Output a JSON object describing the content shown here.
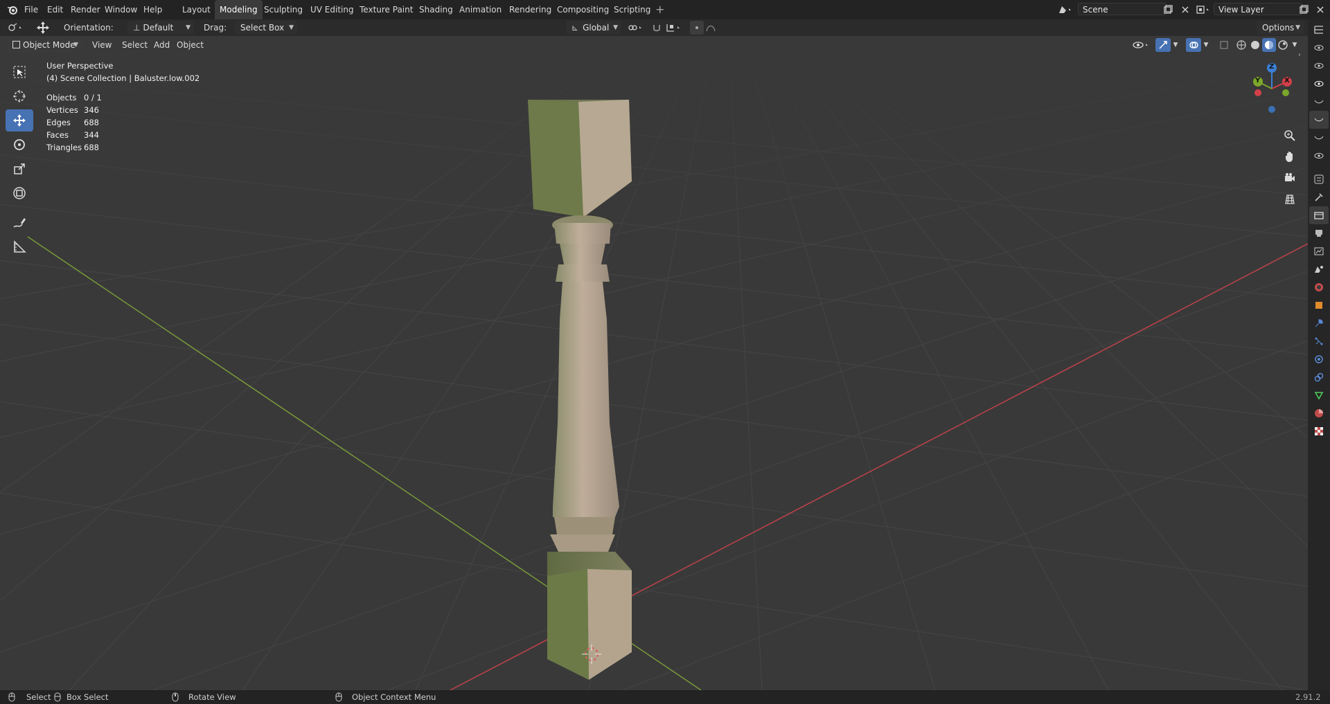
{
  "menu": {
    "items": [
      "File",
      "Edit",
      "Render",
      "Window",
      "Help"
    ]
  },
  "workspaces": {
    "tabs": [
      "Layout",
      "Modeling",
      "Sculpting",
      "UV Editing",
      "Texture Paint",
      "Shading",
      "Animation",
      "Rendering",
      "Compositing",
      "Scripting"
    ],
    "active": "Modeling",
    "add_label": "+"
  },
  "scene": {
    "value": "Scene"
  },
  "view_layer": {
    "value": "View Layer"
  },
  "tool_header": {
    "orientation_label": "Orientation:",
    "orientation_value": "Default",
    "drag_label": "Drag:",
    "drag_value": "Select Box",
    "transform_orientation": "Global",
    "options_label": "Options"
  },
  "viewport_header": {
    "mode": "Object Mode",
    "menus": [
      "View",
      "Select",
      "Add",
      "Object"
    ]
  },
  "overlay": {
    "perspective": "User Perspective",
    "collection": "(4) Scene Collection | Baluster.low.002"
  },
  "stats": [
    {
      "label": "Objects",
      "value": "0 / 1"
    },
    {
      "label": "Vertices",
      "value": "346"
    },
    {
      "label": "Edges",
      "value": "688"
    },
    {
      "label": "Faces",
      "value": "344"
    },
    {
      "label": "Triangles",
      "value": "688"
    }
  ],
  "gizmo": {
    "x": "X",
    "y": "Y",
    "z": "Z"
  },
  "colors": {
    "accent": "#4772b3",
    "x_axis": "#d13f48",
    "y_axis": "#7ba82a",
    "z_axis": "#3b80d6",
    "viewport_bg": "#393939"
  },
  "statusbar": {
    "select": "Select",
    "box_select": "Box Select",
    "rotate_view": "Rotate View",
    "context_menu": "Object Context Menu",
    "version": "2.91.2"
  }
}
